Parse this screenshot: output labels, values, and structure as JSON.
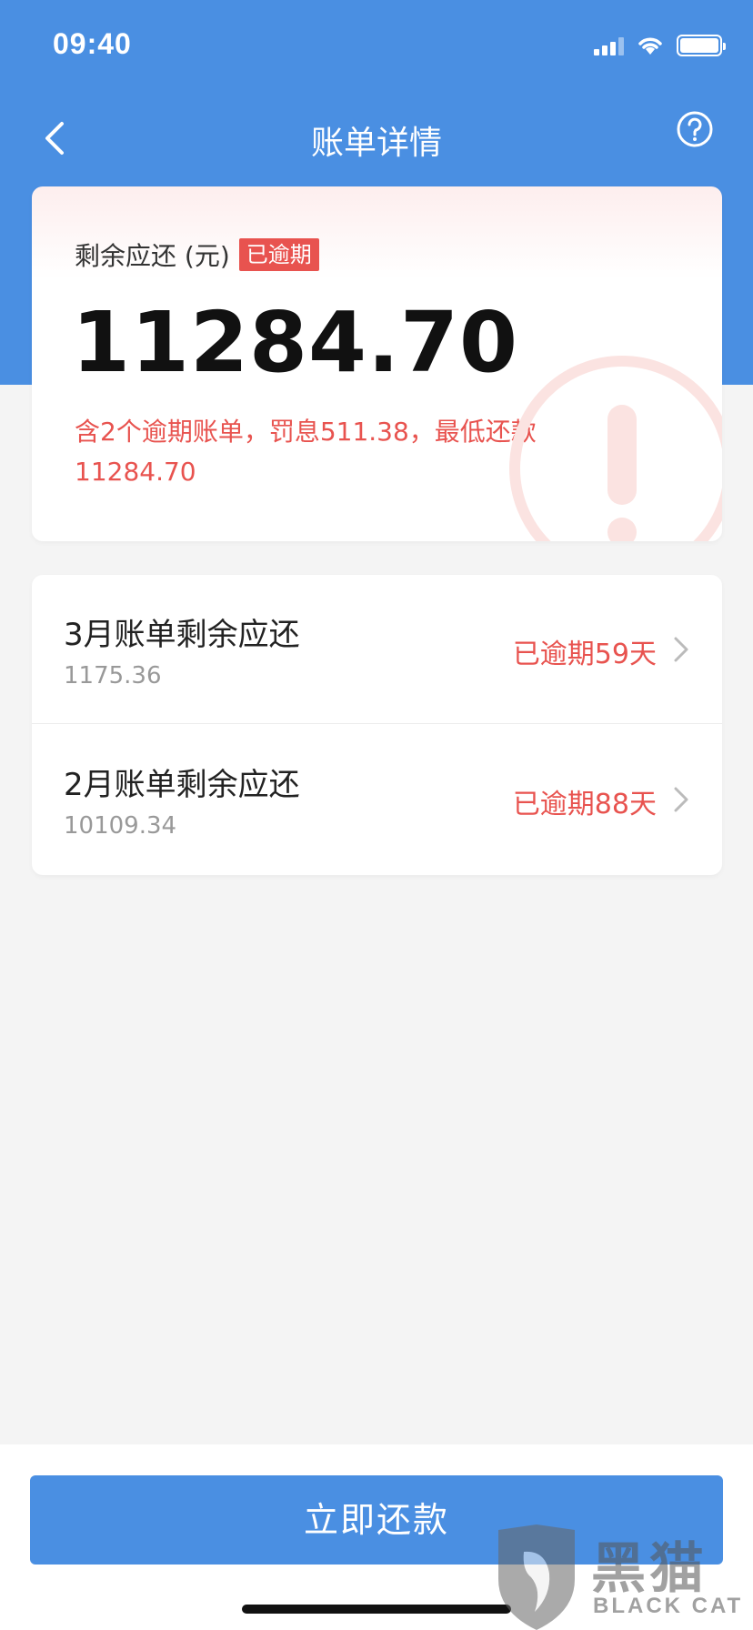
{
  "status_bar": {
    "time": "09:40"
  },
  "nav": {
    "title": "账单详情"
  },
  "summary": {
    "label": "剩余应还 (元)",
    "overdue_tag": "已逾期",
    "amount": "11284.70",
    "note": "含2个逾期账单，罚息511.38，最低还款11284.70"
  },
  "bills": [
    {
      "title": "3月账单剩余应还",
      "amount": "1175.36",
      "status": "已逾期59天"
    },
    {
      "title": "2月账单剩余应还",
      "amount": "10109.34",
      "status": "已逾期88天"
    }
  ],
  "footer": {
    "pay_label": "立即还款"
  },
  "watermark": {
    "cn": "黑猫",
    "en": "BLACK CAT"
  },
  "colors": {
    "brand_blue": "#4a8fe2",
    "alert_red": "#e8534f"
  }
}
